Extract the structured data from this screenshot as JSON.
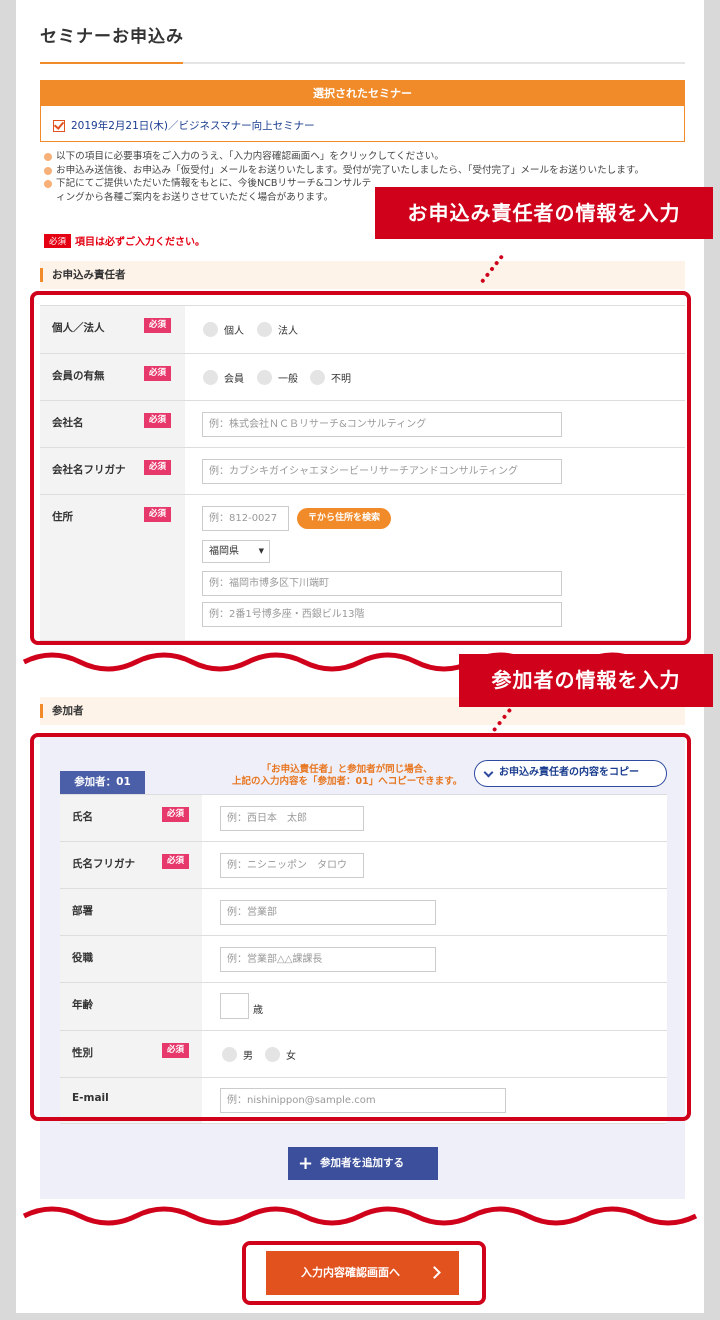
{
  "page": {
    "title": "セミナーお申込み"
  },
  "selected_seminar": {
    "header": "選択されたセミナー",
    "item": "2019年2月21日(木)／ビジネスマナー向上セミナー"
  },
  "notes": [
    "以下の項目に必要事項をご入力のうえ、「入力内容確認画面へ」をクリックしてください。",
    "お申込み送信後、お申込み「仮受付」メールをお送りいたします。受付が完了いたしましたら、「受付完了」メールをお送りいたします。",
    "下記にてご提供いただいた情報をもとに、今後NCBリサーチ&コンサルティングから各種ご案内をお送りさせていただく場合があります。"
  ],
  "required_note": {
    "badge": "必須",
    "text": "項目は必ずご入力ください。"
  },
  "required_badge": "必須",
  "applicant": {
    "section_title": "お申込み責任者",
    "callout": "お申込み責任者の情報を入力",
    "rows": {
      "type": {
        "label": "個人／法人",
        "options": [
          "個人",
          "法人"
        ]
      },
      "member": {
        "label": "会員の有無",
        "options": [
          "会員",
          "一般",
          "不明"
        ]
      },
      "company": {
        "label": "会社名",
        "placeholder": "例：株式会社ＮＣＢリサーチ&コンサルティング"
      },
      "company_kana": {
        "label": "会社名フリガナ",
        "placeholder": "例：カブシキガイシャエヌシービーリサーチアンドコンサルティング"
      },
      "address": {
        "label": "住所",
        "zip_placeholder": "例：812-0027",
        "search_button": "〒から住所を検索",
        "prefecture": "福岡県",
        "address1_placeholder": "例：福岡市博多区下川端町",
        "address2_placeholder": "例：2番1号博多座・西銀ビル13階"
      }
    }
  },
  "participants": {
    "section_title": "参加者",
    "callout": "参加者の情報を入力",
    "tab_label": "参加者：01",
    "copy_note_line1": "「お申込責任者」と参加者が同じ場合、",
    "copy_note_line2": "上記の入力内容を「参加者：01」へコピーできます。",
    "copy_button": "お申込み責任者の内容をコピー",
    "rows": {
      "name": {
        "label": "氏名",
        "placeholder": "例：西日本　太郎"
      },
      "name_kana": {
        "label": "氏名フリガナ",
        "placeholder": "例：ニシニッポン　タロウ"
      },
      "department": {
        "label": "部署",
        "placeholder": "例：営業部"
      },
      "position": {
        "label": "役職",
        "placeholder": "例：営業部△△課課長"
      },
      "age": {
        "label": "年齢",
        "unit": "歳"
      },
      "gender": {
        "label": "性別",
        "options": [
          "男",
          "女"
        ]
      },
      "email": {
        "label": "E-mail",
        "placeholder": "例：nishinippon@sample.com"
      }
    },
    "add_button": "参加者を追加する"
  },
  "submit_button": "入力内容確認画面へ",
  "colors": {
    "accent_orange": "#f18b2a",
    "callout_red": "#d0021b",
    "required_pink": "#e6386b",
    "navy": "#3b4f9c",
    "submit": "#e2521f"
  }
}
